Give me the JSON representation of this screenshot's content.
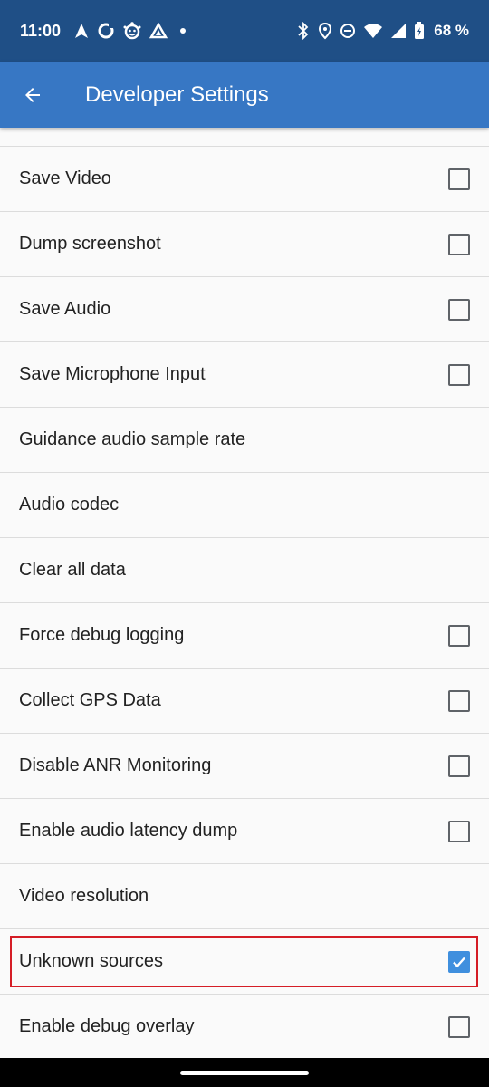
{
  "status_bar": {
    "time": "11:00",
    "battery": "68 %",
    "icons_left": [
      "navigation-icon",
      "sync-icon",
      "face-icon",
      "drive-icon",
      "dot-icon"
    ],
    "icons_right": [
      "bluetooth-icon",
      "location-icon",
      "do-not-disturb-icon",
      "wifi-icon",
      "signal-icon",
      "battery-icon"
    ]
  },
  "app_bar": {
    "title": "Developer Settings",
    "back_icon": "arrow-back-icon"
  },
  "settings": [
    {
      "label": "Save Video",
      "checkbox": true,
      "checked": false
    },
    {
      "label": "Dump screenshot",
      "checkbox": true,
      "checked": false
    },
    {
      "label": "Save Audio",
      "checkbox": true,
      "checked": false
    },
    {
      "label": "Save Microphone Input",
      "checkbox": true,
      "checked": false
    },
    {
      "label": "Guidance audio sample rate",
      "checkbox": false,
      "checked": false
    },
    {
      "label": "Audio codec",
      "checkbox": false,
      "checked": false
    },
    {
      "label": "Clear all data",
      "checkbox": false,
      "checked": false
    },
    {
      "label": "Force debug logging",
      "checkbox": true,
      "checked": false
    },
    {
      "label": "Collect GPS Data",
      "checkbox": true,
      "checked": false
    },
    {
      "label": "Disable ANR Monitoring",
      "checkbox": true,
      "checked": false
    },
    {
      "label": "Enable audio latency dump",
      "checkbox": true,
      "checked": false
    },
    {
      "label": "Video resolution",
      "checkbox": false,
      "checked": false
    },
    {
      "label": "Unknown sources",
      "checkbox": true,
      "checked": true,
      "highlighted": true
    },
    {
      "label": "Enable debug overlay",
      "checkbox": true,
      "checked": false
    }
  ],
  "colors": {
    "status_bar": "#1f4f86",
    "app_bar": "#3777c4",
    "checkbox_checked": "#3f8fde",
    "highlight_border": "#d51d26"
  }
}
